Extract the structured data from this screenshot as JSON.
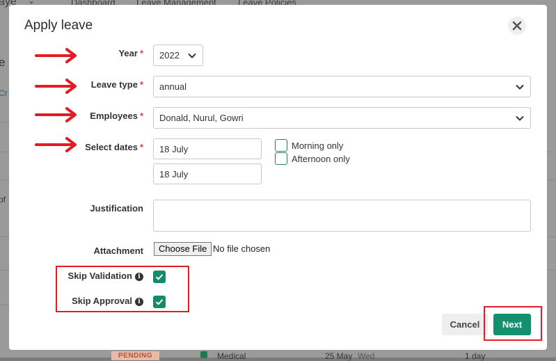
{
  "background": {
    "nav_items": [
      "aye",
      "Dashboard",
      "Leave Management",
      "Leave Policies"
    ],
    "side_fragments": [
      "e",
      "Cr",
      "of"
    ],
    "bottom_row": {
      "status": "PENDING",
      "type": "Medical",
      "date": "25 May",
      "weekday": "Wed",
      "duration": "1 day"
    }
  },
  "modal": {
    "title": "Apply leave",
    "fields": {
      "year": {
        "label": "Year",
        "value": "2022"
      },
      "leave_type": {
        "label": "Leave type",
        "value": "annual"
      },
      "employees": {
        "label": "Employees",
        "value": "Donald, Nurul, Gowri"
      },
      "select_dates": {
        "label": "Select dates",
        "start": "18 July",
        "end": "18 July"
      },
      "justification": {
        "label": "Justification",
        "value": ""
      },
      "attachment": {
        "label": "Attachment",
        "button": "Choose File",
        "status": "No file chosen"
      }
    },
    "required_marker": "*",
    "options": {
      "morning_only": "Morning only",
      "afternoon_only": "Afternoon only"
    },
    "skip_validation": {
      "label": "Skip Validation",
      "checked": true
    },
    "skip_approval": {
      "label": "Skip Approval",
      "checked": true
    },
    "buttons": {
      "cancel": "Cancel",
      "next": "Next"
    }
  },
  "colors": {
    "accent": "#14906f",
    "required": "#e0433e",
    "annotation": "#e31b23"
  }
}
